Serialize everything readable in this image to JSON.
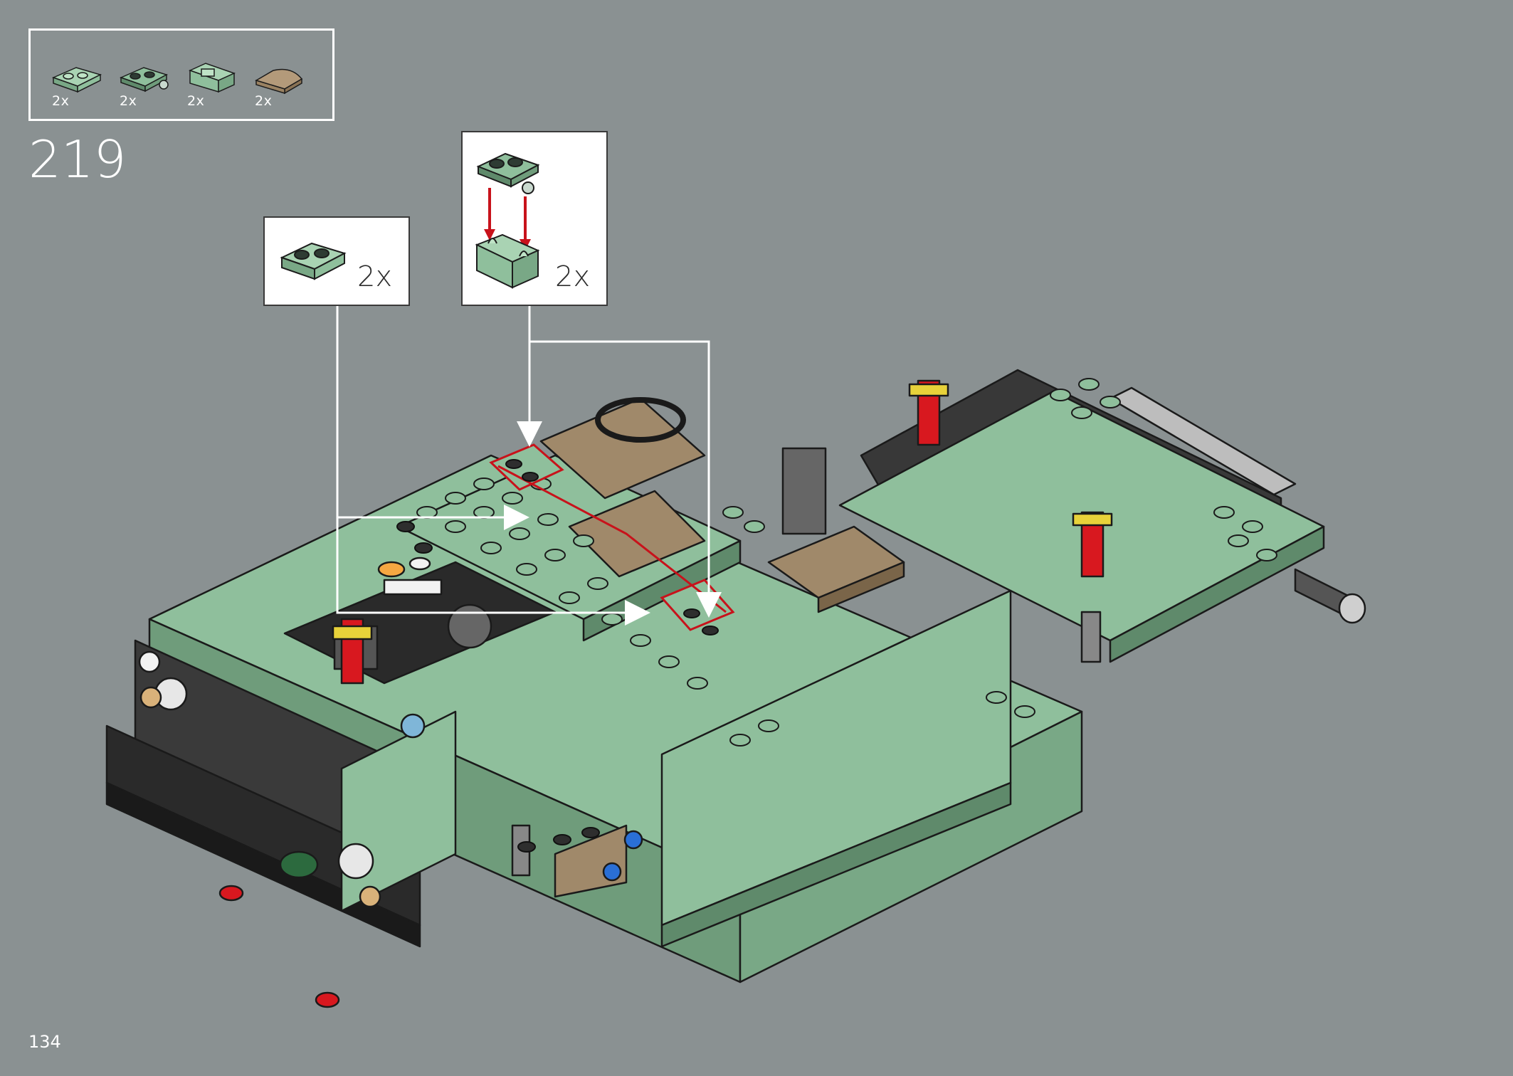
{
  "step": {
    "number": "219"
  },
  "page": {
    "number": "134"
  },
  "parts_list": [
    {
      "qty": "2x",
      "icon": "sand-green-plate-1x2-icon",
      "color": "#8fbf9c"
    },
    {
      "qty": "2x",
      "icon": "sand-green-plate-clip-icon",
      "color": "#8fbf9c"
    },
    {
      "qty": "2x",
      "icon": "sand-green-bracket-icon",
      "color": "#8fbf9c"
    },
    {
      "qty": "2x",
      "icon": "tan-curved-slope-icon",
      "color": "#a0896a"
    }
  ],
  "callouts": {
    "plate": {
      "qty": "2x"
    },
    "clip_assembly": {
      "qty": "2x"
    }
  },
  "colors": {
    "sand_green": "#8fbf9c",
    "dark_tan": "#a0896a",
    "black": "#2e2e2e",
    "red": "#d8181f",
    "highlight_red": "#c8121b"
  }
}
